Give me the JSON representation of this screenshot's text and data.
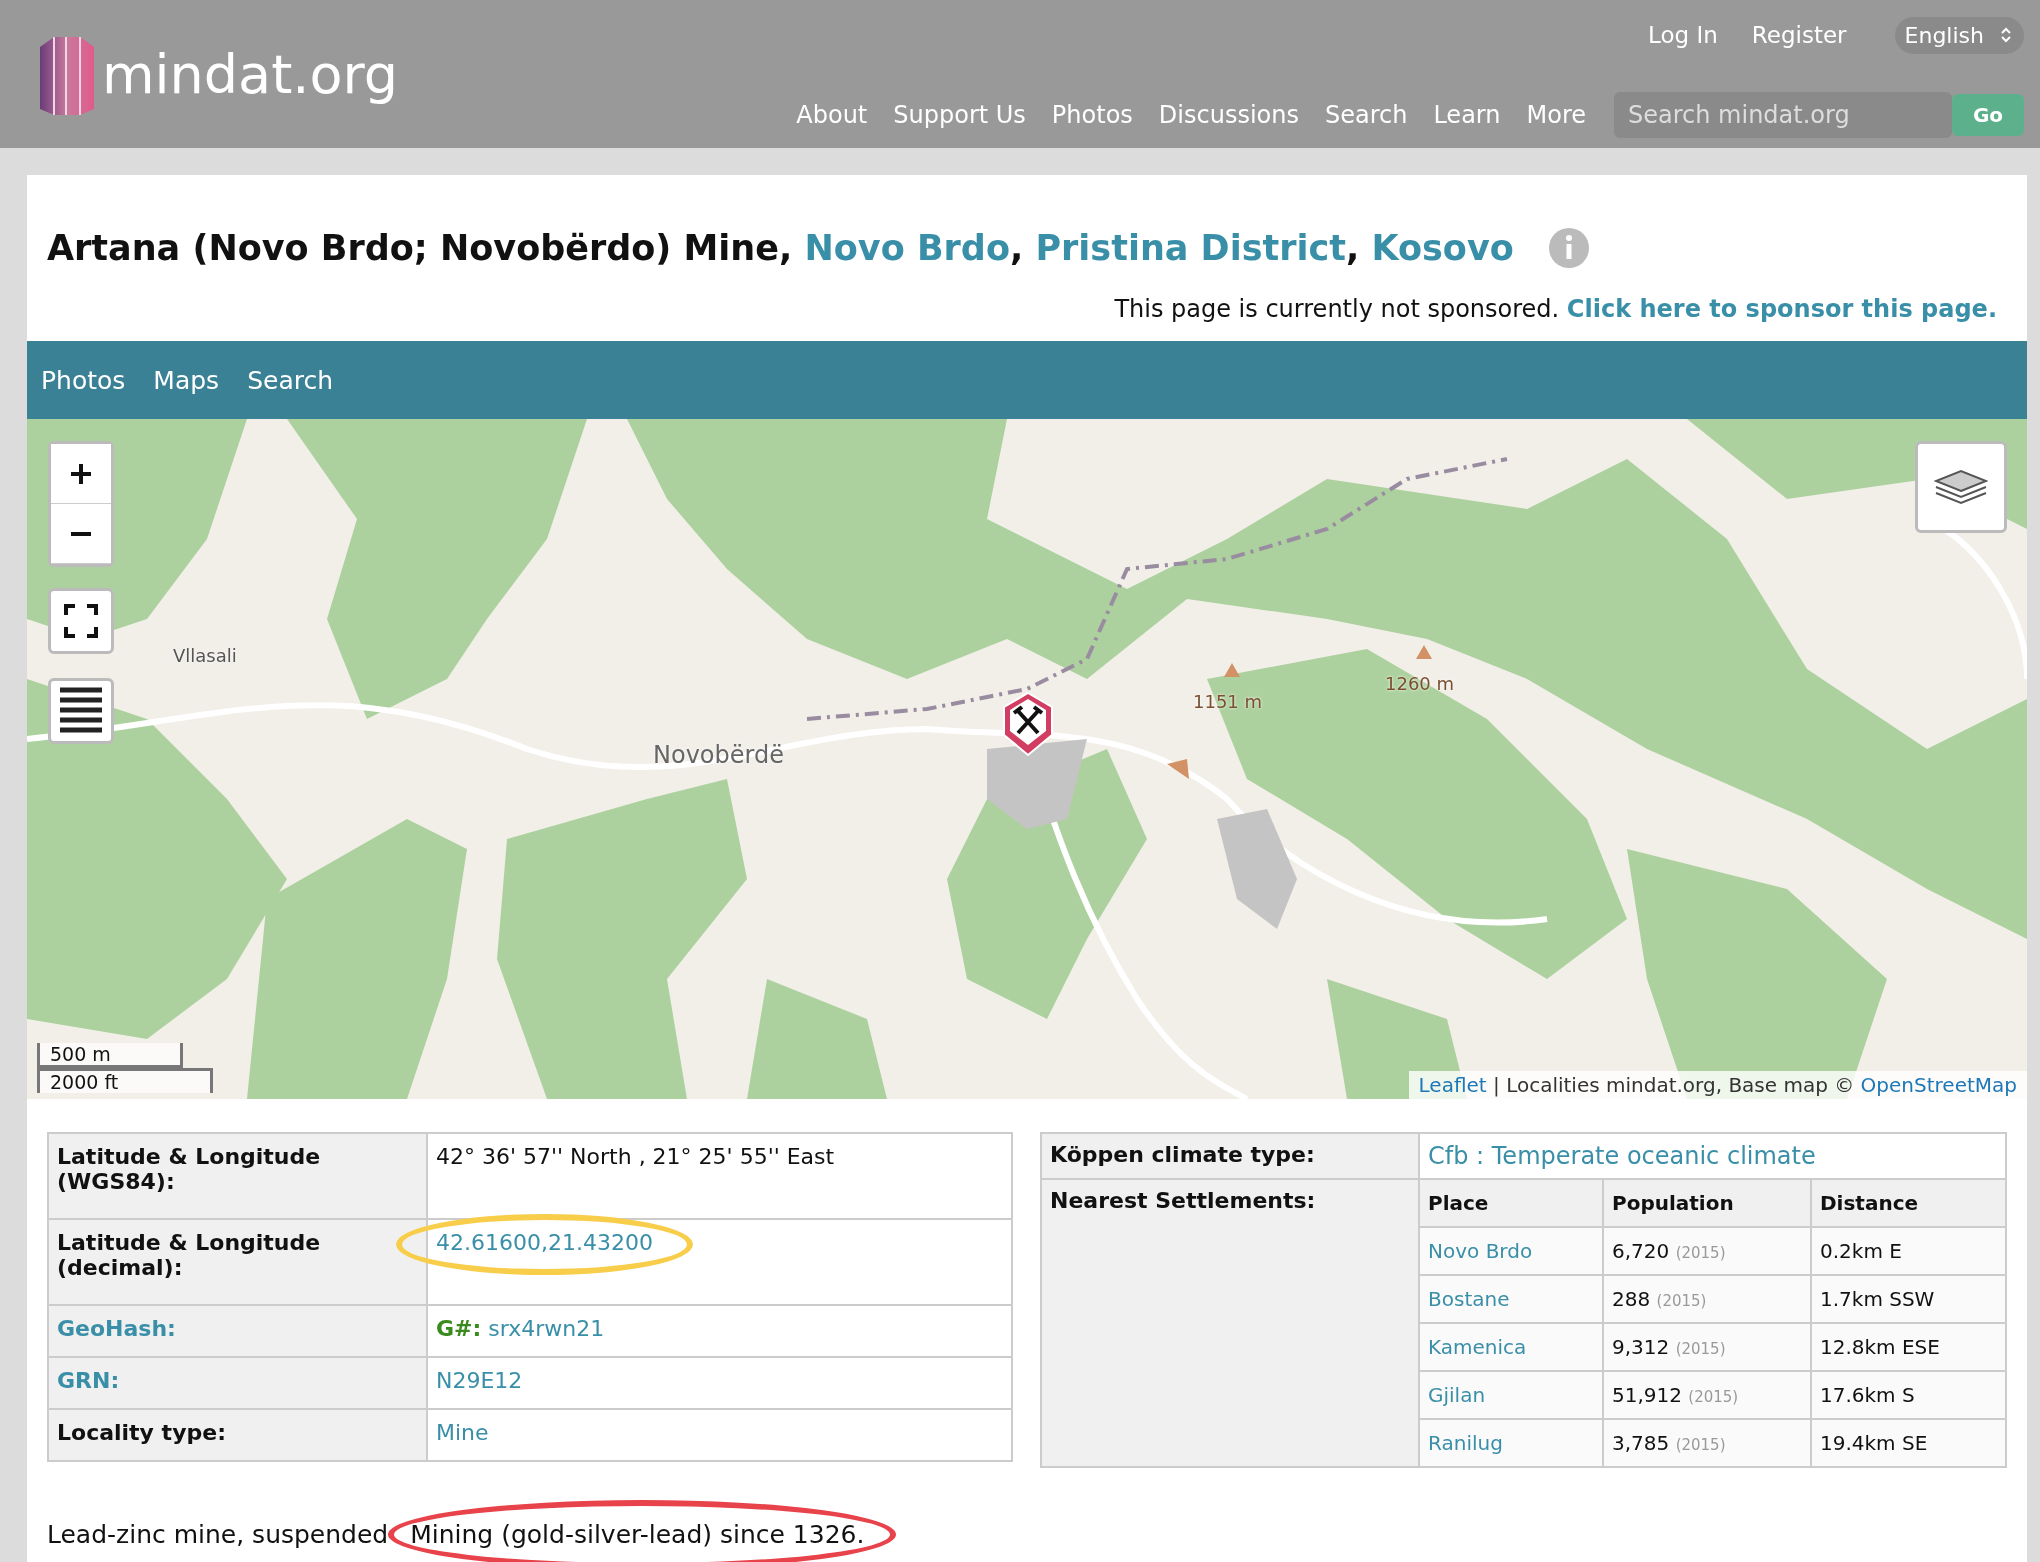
{
  "header": {
    "logo": "mindat.org",
    "top_links": [
      "Log In",
      "Register"
    ],
    "language": "English",
    "nav": [
      "About",
      "Support Us",
      "Photos",
      "Discussions",
      "Search",
      "Learn",
      "More"
    ],
    "search": {
      "placeholder": "Search mindat.org"
    },
    "go_button": "Go"
  },
  "title": {
    "text": "Artana (Novo Brdo; Novobërdo) Mine",
    "separator": ",",
    "links": [
      "Novo Brdo",
      "Pristina District",
      "Kosovo"
    ]
  },
  "sponsor": {
    "text": "This page is currently not sponsored.",
    "link": "Click here to sponsor this page."
  },
  "tabs": [
    "Photos",
    "Maps",
    "Search"
  ],
  "map": {
    "labels": [
      {
        "text": "Vllasali",
        "kind": "place"
      },
      {
        "text": "Novobërdë",
        "kind": "town"
      },
      {
        "text": "1151 m",
        "kind": "peak"
      },
      {
        "text": "1260 m",
        "kind": "peak"
      }
    ],
    "scale": [
      "500 m",
      "2000 ft"
    ],
    "attribution": {
      "leaflet": "Leaflet",
      "text": "| Localities mindat.org, Base map ©",
      "osm": "OpenStreetMap"
    }
  },
  "location_table": {
    "rows": [
      {
        "label": "Latitude & Longitude (WGS84):",
        "label_link": false,
        "value": "42° 36' 57'' North , 21° 25' 55'' East",
        "kind": "text"
      },
      {
        "label": "Latitude & Longitude (decimal):",
        "label_link": false,
        "value": "42.61600,21.43200",
        "kind": "link",
        "circled": true
      },
      {
        "label": "GeoHash:",
        "label_link": true,
        "prefix": "G#:",
        "value": "srx4rwn21",
        "kind": "geohash"
      },
      {
        "label": "GRN:",
        "label_link": true,
        "value": "N29E12",
        "kind": "link"
      },
      {
        "label": "Locality type:",
        "label_link": false,
        "value": "Mine",
        "kind": "link"
      }
    ]
  },
  "climate": {
    "label": "Köppen climate type:",
    "value": "Cfb : Temperate oceanic climate"
  },
  "settlements": {
    "label": "Nearest Settlements:",
    "columns": [
      "Place",
      "Population",
      "Distance"
    ],
    "rows": [
      {
        "place": "Novo Brdo",
        "population": "6,720",
        "year": "(2015)",
        "distance": "0.2km E"
      },
      {
        "place": "Bostane",
        "population": "288",
        "year": "(2015)",
        "distance": "1.7km SSW"
      },
      {
        "place": "Kamenica",
        "population": "9,312",
        "year": "(2015)",
        "distance": "12.8km ESE"
      },
      {
        "place": "Gjilan",
        "population": "51,912",
        "year": "(2015)",
        "distance": "17.6km S"
      },
      {
        "place": "Ranilug",
        "population": "3,785",
        "year": "(2015)",
        "distance": "19.4km SE"
      }
    ]
  },
  "description": {
    "text": "Lead-zinc mine, suspended",
    "circled": "Mining (gold-silver-lead) since 1326."
  }
}
